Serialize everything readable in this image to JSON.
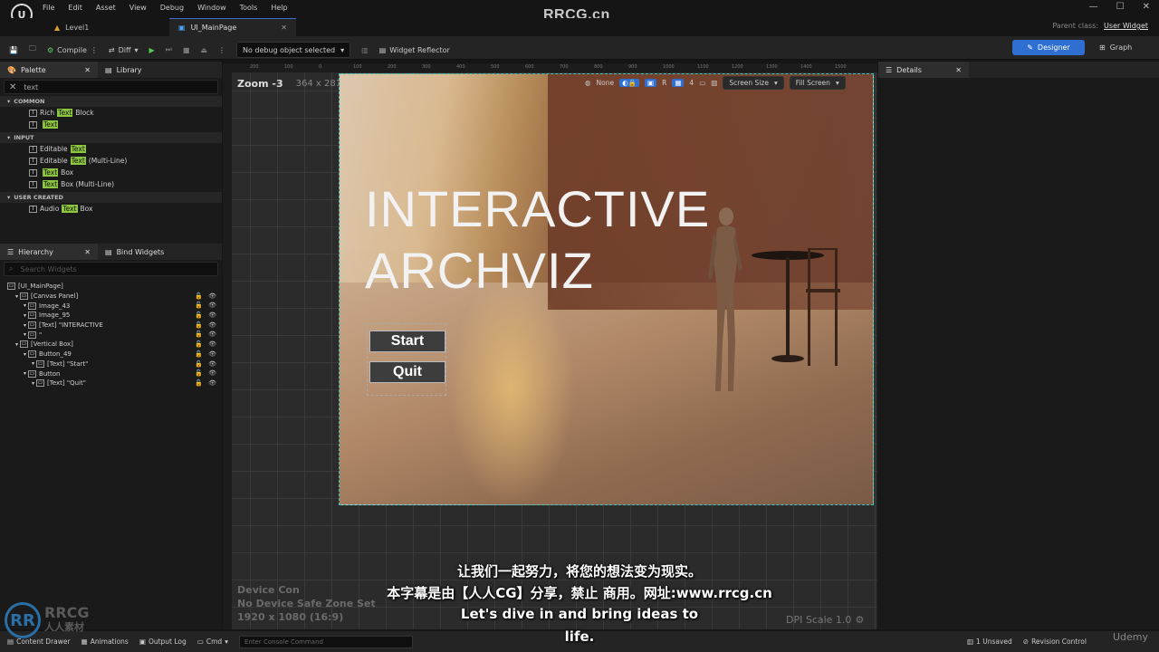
{
  "menu": [
    "File",
    "Edit",
    "Asset",
    "View",
    "Debug",
    "Window",
    "Tools",
    "Help"
  ],
  "brand_watermark": "RRCG.cn",
  "tabs": [
    {
      "label": "Level1"
    },
    {
      "label": "UI_MainPage"
    }
  ],
  "parent_class": {
    "label": "Parent class:",
    "value": "User Widget"
  },
  "toolbar": {
    "compile": "Compile",
    "diff": "Diff",
    "debug_dropdown": "No debug object selected",
    "widget_reflector": "Widget Reflector",
    "designer": "Designer",
    "graph": "Graph"
  },
  "palette": {
    "tab": "Palette",
    "library_tab": "Library",
    "search_value": "text",
    "categories": [
      {
        "name": "COMMON",
        "items": [
          {
            "pre": "Rich ",
            "hl": "Text",
            "post": " Block"
          },
          {
            "pre": "",
            "hl": "Text",
            "post": ""
          }
        ]
      },
      {
        "name": "INPUT",
        "items": [
          {
            "pre": "Editable ",
            "hl": "Text",
            "post": ""
          },
          {
            "pre": "Editable ",
            "hl": "Text",
            "post": " (Multi-Line)"
          },
          {
            "pre": "",
            "hl": "Text",
            "post": " Box"
          },
          {
            "pre": "",
            "hl": "Text",
            "post": " Box (Multi-Line)"
          }
        ]
      },
      {
        "name": "USER CREATED",
        "items": [
          {
            "pre": "Audio ",
            "hl": "Text",
            "post": " Box"
          }
        ]
      }
    ]
  },
  "hierarchy": {
    "tab": "Hierarchy",
    "bind_tab": "Bind Widgets",
    "search_placeholder": "Search Widgets",
    "rows": [
      {
        "label": "[UI_MainPage]",
        "indent": 0
      },
      {
        "label": "[Canvas Panel]",
        "indent": 1
      },
      {
        "label": "Image_43",
        "indent": 2
      },
      {
        "label": "Image_95",
        "indent": 2
      },
      {
        "label": "[Text] \"INTERACTIVE",
        "indent": 2
      },
      {
        "label": "\"",
        "indent": 2
      },
      {
        "label": "[Vertical Box]",
        "indent": 1
      },
      {
        "label": "Button_49",
        "indent": 2
      },
      {
        "label": "[Text] \"Start\"",
        "indent": 3
      },
      {
        "label": "Button",
        "indent": 2
      },
      {
        "label": "[Text] \"Quit\"",
        "indent": 3
      }
    ]
  },
  "viewport": {
    "zoom": "Zoom -3",
    "size": "364 x 281",
    "none_label": "None",
    "r_label": "R",
    "grid_value": "4",
    "screen_size": "Screen Size",
    "fill_screen": "Fill Screen",
    "ruler_ticks": [
      "200",
      "100",
      "0",
      "100",
      "200",
      "300",
      "400",
      "500",
      "600",
      "700",
      "800",
      "900",
      "1000",
      "1100",
      "1200",
      "1300",
      "1400",
      "1500"
    ],
    "device_lines": [
      "Device Con",
      "No Device Safe Zone Set",
      "1920 x 1080 (16:9)"
    ],
    "dpi": "DPI Scale 1.0"
  },
  "game_ui": {
    "title_line1": "INTERACTIVE",
    "title_line2": "ARCHVIZ",
    "start": "Start",
    "quit": "Quit"
  },
  "details": {
    "tab": "Details"
  },
  "bottom": {
    "content_drawer": "Content Drawer",
    "animations": "Animations",
    "output_log": "Output Log",
    "cmd": "Cmd",
    "console_placeholder": "Enter Console Command",
    "unsaved": "1 Unsaved",
    "revision": "Revision Control"
  },
  "subtitles": {
    "line1": "让我们一起努力，将您的想法变为现实。",
    "line2": "本字幕是由【人人CG】分享，禁止 商用。网址:www.rrcg.cn",
    "line3": "Let's dive in and bring ideas to",
    "line4": "life."
  },
  "watermark": {
    "logo": "RR",
    "text1": "RRCG",
    "text2": "人人素材"
  },
  "udemy": "Udemy"
}
